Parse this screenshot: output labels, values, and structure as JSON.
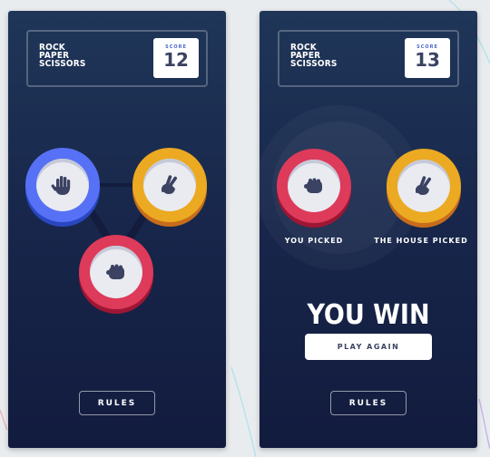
{
  "colors": {
    "background_gradient_top": "#1f3658",
    "background_gradient_bottom": "#121b3e",
    "paper": "#5671f5",
    "scissors": "#eca922",
    "rock": "#de3a5a",
    "score_label": "#4a67c7",
    "dark_text": "#3b4262"
  },
  "screen_select": {
    "logo": {
      "line1": "ROCK",
      "line2": "PAPER",
      "line3": "SCISSORS"
    },
    "score": {
      "label": "SCORE",
      "value": "12"
    },
    "choices": [
      {
        "name": "paper",
        "icon": "hand-paper-icon"
      },
      {
        "name": "scissors",
        "icon": "hand-scissors-icon"
      },
      {
        "name": "rock",
        "icon": "hand-rock-icon"
      }
    ],
    "rules_label": "RULES"
  },
  "screen_result": {
    "logo": {
      "line1": "ROCK",
      "line2": "PAPER",
      "line3": "SCISSORS"
    },
    "score": {
      "label": "SCORE",
      "value": "13"
    },
    "you_picked_label": "YOU PICKED",
    "you_picked": {
      "name": "rock",
      "icon": "hand-rock-icon"
    },
    "house_picked_label": "THE HOUSE PICKED",
    "house_picked": {
      "name": "scissors",
      "icon": "hand-scissors-icon"
    },
    "result_text": "YOU WIN",
    "play_again_label": "PLAY AGAIN",
    "rules_label": "RULES"
  }
}
